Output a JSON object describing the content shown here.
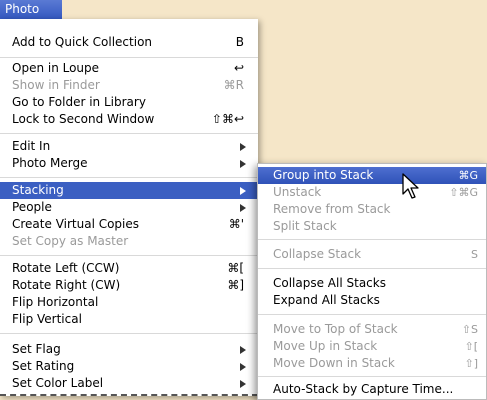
{
  "menubar": {
    "title": "Photo"
  },
  "main_menu": {
    "items": [
      {
        "label": "Add to Quick Collection",
        "shortcut": "B"
      },
      {
        "label": "Open in Loupe",
        "shortcut": "↩"
      },
      {
        "label": "Show in Finder",
        "shortcut": "⌘R"
      },
      {
        "label": "Go to Folder in Library",
        "shortcut": ""
      },
      {
        "label": "Lock to Second Window",
        "shortcut": "⇧⌘↩"
      },
      {
        "label": "Edit In",
        "shortcut": ""
      },
      {
        "label": "Photo Merge",
        "shortcut": ""
      },
      {
        "label": "Stacking",
        "shortcut": ""
      },
      {
        "label": "People",
        "shortcut": ""
      },
      {
        "label": "Create Virtual Copies",
        "shortcut": "⌘'"
      },
      {
        "label": "Set Copy as Master",
        "shortcut": ""
      },
      {
        "label": "Rotate Left (CCW)",
        "shortcut": "⌘["
      },
      {
        "label": "Rotate Right (CW)",
        "shortcut": "⌘]"
      },
      {
        "label": "Flip Horizontal",
        "shortcut": ""
      },
      {
        "label": "Flip Vertical",
        "shortcut": ""
      },
      {
        "label": "Set Flag",
        "shortcut": ""
      },
      {
        "label": "Set Rating",
        "shortcut": ""
      },
      {
        "label": "Set Color Label",
        "shortcut": ""
      }
    ]
  },
  "stacking_submenu": {
    "items": [
      {
        "label": "Group into Stack",
        "shortcut": "⌘G"
      },
      {
        "label": "Unstack",
        "shortcut": "⇧⌘G"
      },
      {
        "label": "Remove from Stack",
        "shortcut": ""
      },
      {
        "label": "Split Stack",
        "shortcut": ""
      },
      {
        "label": "Collapse Stack",
        "shortcut": "S"
      },
      {
        "label": "Collapse All Stacks",
        "shortcut": ""
      },
      {
        "label": "Expand All Stacks",
        "shortcut": ""
      },
      {
        "label": "Move to Top of Stack",
        "shortcut": "⇧S"
      },
      {
        "label": "Move Up in Stack",
        "shortcut": "⇧["
      },
      {
        "label": "Move Down in Stack",
        "shortcut": "⇧]"
      },
      {
        "label": "Auto-Stack by Capture Time...",
        "shortcut": ""
      }
    ]
  },
  "colors": {
    "highlight": "#3b5fc2",
    "disabled": "#9a9a9a",
    "background": "#f5e6c8"
  },
  "icons": {
    "pointer": "mouse-pointer-icon",
    "submenu": "submenu-arrow-icon"
  }
}
